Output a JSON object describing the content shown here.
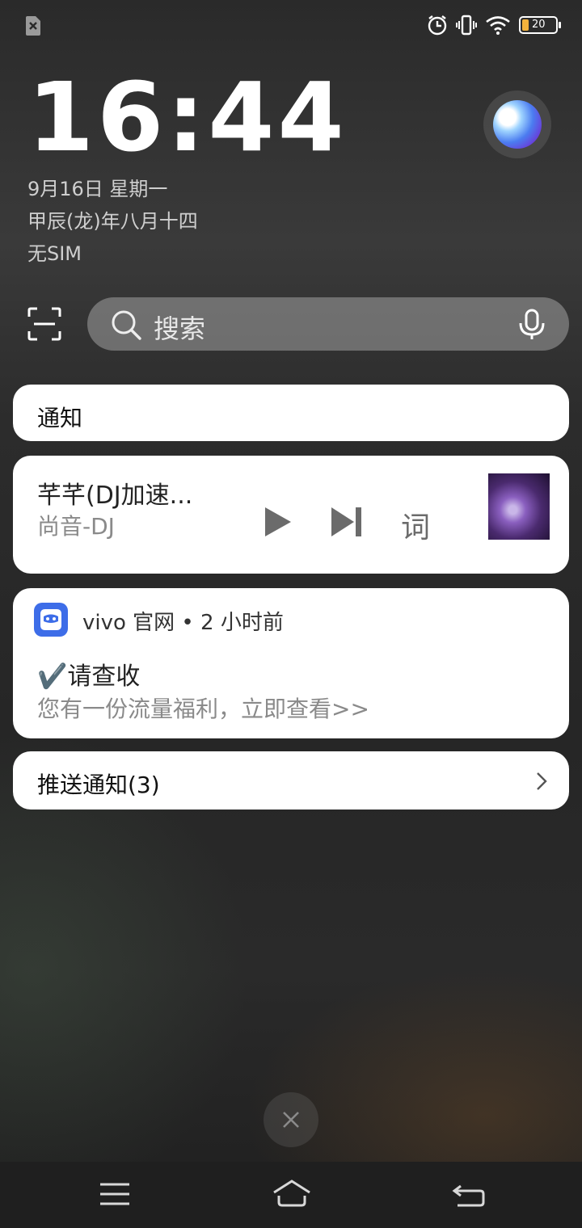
{
  "status_bar": {
    "left_icon": "no-sim-icon",
    "right_icons": [
      "alarm-icon",
      "vibrate-icon",
      "wifi-icon"
    ],
    "battery_level": "20",
    "battery_color": "#f3b23c"
  },
  "lockscreen": {
    "time": "16:44",
    "date": "9月16日 星期一",
    "lunar_date": "甲辰(龙)年八月十四",
    "sim_status": "无SIM"
  },
  "search": {
    "placeholder": "搜索",
    "left_icon": "scan-icon",
    "right_icon": "microphone-icon"
  },
  "notifications": {
    "header": "通知",
    "music": {
      "title": "芊芊(DJ加速...",
      "artist": "尚音-DJ",
      "play_icon": "play-icon",
      "next_icon": "skip-next-icon",
      "lyrics_label": "词"
    },
    "vivo": {
      "app_meta": "vivo 官网 • 2 小时前",
      "title": "✔️请查收",
      "body": "您有一份流量福利，立即查看>>"
    },
    "push_group": {
      "label": "推送通知(3)"
    }
  },
  "nav_bar": {
    "menu_icon": "menu-icon",
    "home_icon": "home-icon",
    "back_icon": "back-icon"
  },
  "colors": {
    "card_bg": "#ffffff",
    "vivo_brand": "#3d6de8",
    "secondary_text": "#8a8a8a"
  }
}
